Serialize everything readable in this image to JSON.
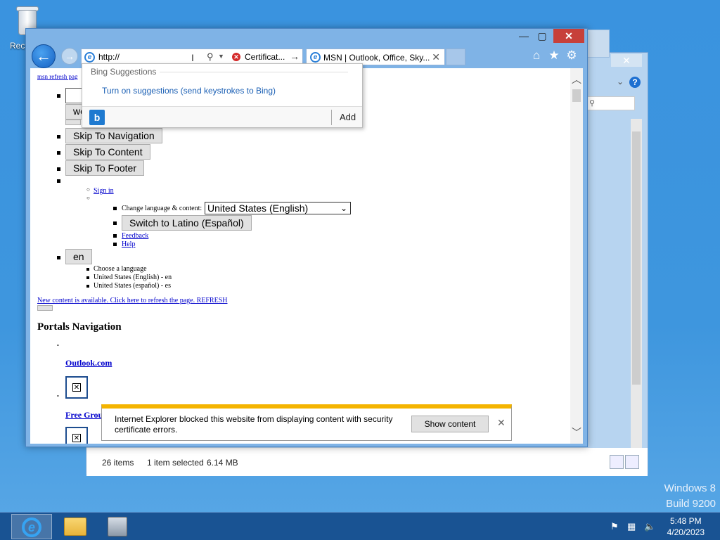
{
  "desktop": {
    "recycle_bin_label": "Recycle Bin",
    "watermark": {
      "line1": "Windows 8",
      "line2": "Build 9200"
    }
  },
  "explorer": {
    "status": {
      "items": "26 items",
      "selected": "1 item selected",
      "size": "6.14 MB"
    },
    "close_glyph": "✕",
    "help_glyph": "?"
  },
  "ie": {
    "window_buttons": {
      "minimize": "—",
      "maximize": "▢",
      "close": "✕"
    },
    "address": {
      "value": "http://",
      "certificate_label": "Certificat..."
    },
    "tab": {
      "title": "MSN | Outlook, Office, Sky...",
      "close": "✕"
    },
    "suggestions": {
      "header": "Bing Suggestions",
      "turn_on": "Turn on suggestions (send keystrokes to Bing)",
      "add": "Add"
    },
    "page": {
      "refresh_link": "msn refresh pag",
      "search_button_partial": "we",
      "skip_nav": "Skip To Navigation",
      "skip_content": "Skip To Content",
      "skip_footer": "Skip To Footer",
      "sign_in": "Sign in",
      "change_language_label": "Change language & content:",
      "language_select": "United States (English)",
      "switch_latino": "Switch to Latino (Español)",
      "feedback": "Feedback",
      "help": "Help",
      "en_button": "en",
      "choose_language": "Choose a language",
      "lang_en": "United States (English) - en",
      "lang_es": "United States (español) - es",
      "new_content": "New content is available. Click here to refresh the page. REFRESH",
      "portals_heading": "Portals Navigation",
      "outlook_link": "Outlook.com",
      "free_group": "Free Grou"
    },
    "notification": {
      "message": "Internet Explorer blocked this website from displaying content with security certificate errors.",
      "show_content": "Show content",
      "close": "✕"
    }
  },
  "taskbar": {
    "clock_time": "5:48 PM",
    "clock_date": "4/20/2023"
  },
  "colors": {
    "desktop": "#3a93df",
    "ie_frame": "#7fb3e6",
    "close_red": "#c7403a",
    "notify_accent": "#f4b400",
    "link": "#0000cc"
  }
}
